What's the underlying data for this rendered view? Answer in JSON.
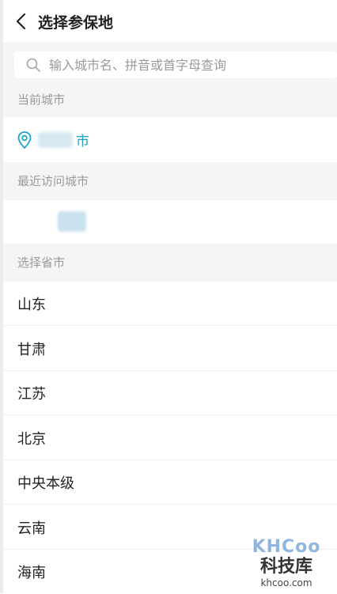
{
  "header": {
    "title": "选择参保地"
  },
  "search": {
    "placeholder": "输入城市名、拼音或首字母查询"
  },
  "sections": {
    "current_city": "当前城市",
    "recent_cities": "最近访问城市",
    "select_province": "选择省市"
  },
  "current_city": {
    "suffix": "市"
  },
  "provinces": [
    "山东",
    "甘肃",
    "江苏",
    "北京",
    "中央本级",
    "云南",
    "海南"
  ],
  "watermark": {
    "logo": "KHCoo",
    "name": "科技库",
    "url": "khcoo.com"
  },
  "colors": {
    "accent": "#1aa3c8",
    "section_bg": "#f5f5f5",
    "section_text": "#9a9a9a"
  }
}
